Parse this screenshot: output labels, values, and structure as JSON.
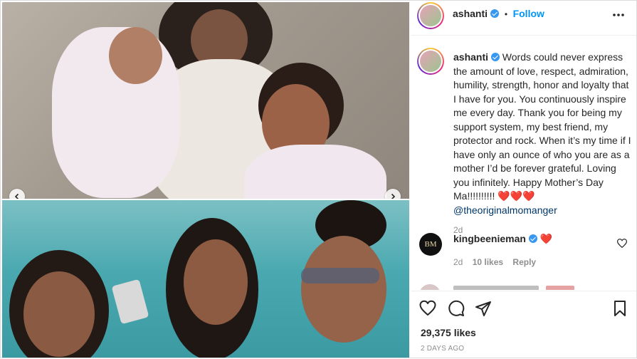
{
  "post": {
    "username": "ashanti",
    "follow_label": "Follow",
    "dot": "•",
    "more_icon": "more-horizontal-icon"
  },
  "caption": {
    "username": "ashanti",
    "text": "Words could never express the amount of love, respect, admiration, humility, strength, honor and loyalty that I have for you. You continuously inspire me every day. Thank you for being my support system, my best friend, my protector and rock. When it’s my time if I have only an ounce of who you are as a mother I’d be forever grateful. Loving you infinitely. Happy Mother’s Day Ma!!!!!!!!!! ",
    "hearts": "❤️❤️❤️",
    "mention": "@theoriginalmomanger",
    "time": "2d"
  },
  "comment": {
    "username": "kingbeenieman",
    "heart": "❤️",
    "time": "2d",
    "likes": "10 likes",
    "reply": "Reply",
    "avatar_text": "BM"
  },
  "footer": {
    "likes": "29,375 likes",
    "posted": "2 DAYS AGO"
  },
  "colors": {
    "accent": "#0095f6",
    "verified": "#3897f0",
    "heart": "#ed4956"
  }
}
